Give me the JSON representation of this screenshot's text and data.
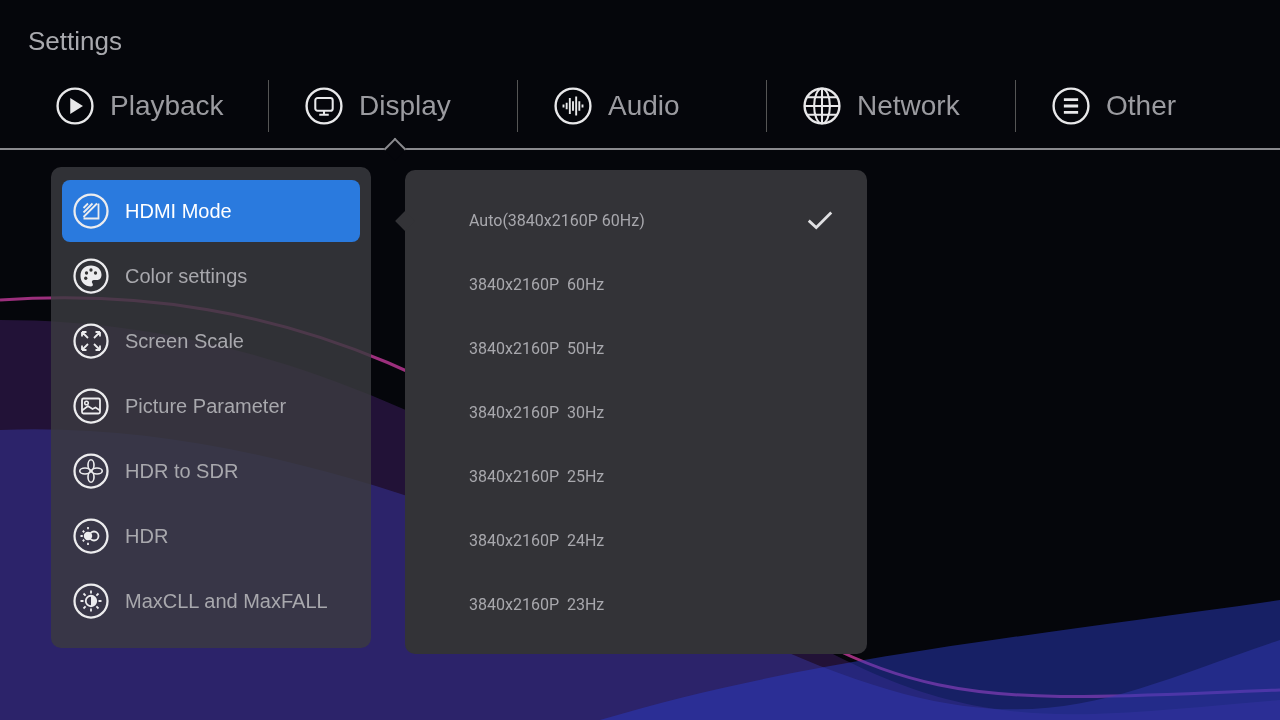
{
  "window": {
    "title": "Settings"
  },
  "tabs": [
    {
      "label": "Playback",
      "selected": false
    },
    {
      "label": "Display",
      "selected": true
    },
    {
      "label": "Audio",
      "selected": false
    },
    {
      "label": "Network",
      "selected": false
    },
    {
      "label": "Other",
      "selected": false
    }
  ],
  "menu": {
    "items": [
      {
        "label": "HDMI Mode",
        "selected": true
      },
      {
        "label": "Color settings",
        "selected": false
      },
      {
        "label": "Screen Scale",
        "selected": false
      },
      {
        "label": "Picture Parameter",
        "selected": false
      },
      {
        "label": "HDR to SDR",
        "selected": false
      },
      {
        "label": "HDR",
        "selected": false
      },
      {
        "label": "MaxCLL and MaxFALL",
        "selected": false
      }
    ]
  },
  "options": [
    {
      "label": "Auto(3840x2160P 60Hz)",
      "selected": true
    },
    {
      "label": "3840x2160P  60Hz",
      "selected": false
    },
    {
      "label": "3840x2160P  50Hz",
      "selected": false
    },
    {
      "label": "3840x2160P  30Hz",
      "selected": false
    },
    {
      "label": "3840x2160P  25Hz",
      "selected": false
    },
    {
      "label": "3840x2160P  24Hz",
      "selected": false
    },
    {
      "label": "3840x2160P  23Hz",
      "selected": false
    }
  ]
}
